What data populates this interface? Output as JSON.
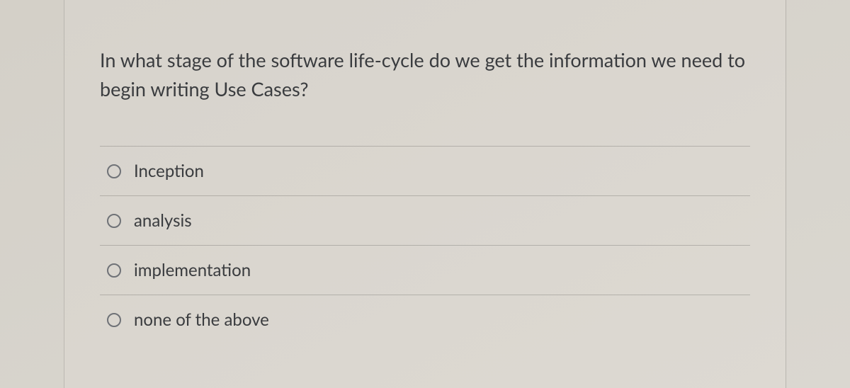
{
  "question": {
    "text": "In what stage of the software life-cycle do we get the information we need to begin writing Use Cases?"
  },
  "options": [
    {
      "label": "Inception"
    },
    {
      "label": "analysis"
    },
    {
      "label": "implementation"
    },
    {
      "label": "none of the above"
    }
  ]
}
